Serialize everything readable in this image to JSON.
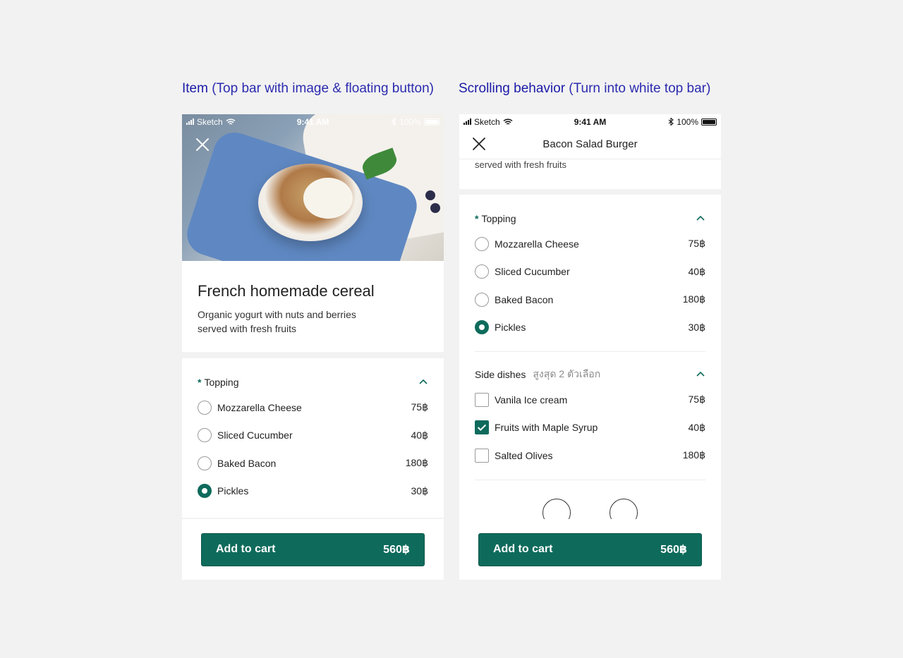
{
  "captions": {
    "left_bold": "Item",
    "left_rest": " (Top bar with image & floating button)",
    "right_bold": "Scrolling behavior",
    "right_rest": " (Turn into white top bar)"
  },
  "status_bar": {
    "carrier": "Sketch",
    "time": "9:41 AM",
    "battery": "100%"
  },
  "item": {
    "title": "French homemade cereal",
    "description": "Organic yogurt with nuts and berries served with fresh fruits"
  },
  "right_screen": {
    "top_bar_title": "Bacon Salad Burger",
    "scrolled_text": "served with fresh fruits"
  },
  "topping": {
    "required_mark": "*",
    "title": "Topping",
    "options": [
      {
        "label": "Mozzarella Cheese",
        "price": "75฿",
        "selected": false
      },
      {
        "label": "Sliced Cucumber",
        "price": "40฿",
        "selected": false
      },
      {
        "label": "Baked Bacon",
        "price": "180฿",
        "selected": false
      },
      {
        "label": "Pickles",
        "price": "30฿",
        "selected": true
      }
    ]
  },
  "side_dishes": {
    "title": "Side dishes",
    "subtitle": "สูงสุด 2 ตัวเลือก",
    "options": [
      {
        "label": "Vanila Ice cream",
        "price": "75฿",
        "checked": false
      },
      {
        "label": "Fruits with Maple Syrup",
        "price": "40฿",
        "checked": true
      },
      {
        "label": "Salted Olives",
        "price": "180฿",
        "checked": false
      }
    ]
  },
  "cart": {
    "label": "Add to cart",
    "total": "560฿"
  },
  "colors": {
    "accent": "#0e6b5c",
    "caption": "#2b2bb0",
    "background": "#f2f2f2"
  }
}
